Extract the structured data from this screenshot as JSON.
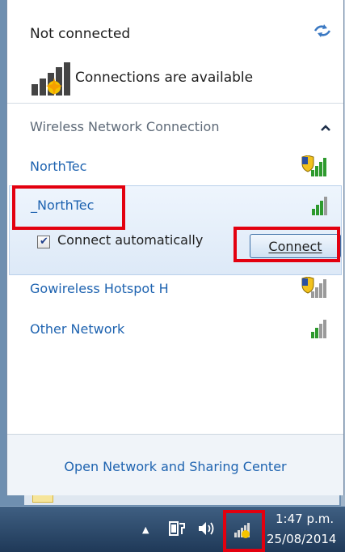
{
  "header": {
    "status": "Not connected",
    "available": "Connections are available"
  },
  "section": {
    "title": "Wireless Network Connection"
  },
  "networks": [
    {
      "name": "NorthTec",
      "secured": true
    },
    {
      "name": "_NorthTec",
      "secured": false
    },
    {
      "name": "Gowireless Hotspot H",
      "secured": true
    },
    {
      "name": "Other Network",
      "secured": false
    }
  ],
  "selected": {
    "connect_auto_label": "Connect automatically",
    "connect_auto_checked": true,
    "connect_label": "Connect"
  },
  "footer": {
    "link": "Open Network and Sharing Center"
  },
  "taskbar": {
    "time": "1:47 p.m.",
    "date": "25/08/2014"
  },
  "colors": {
    "link_blue": "#1e63b0",
    "highlight": "#e3000f",
    "signal_green": "#2e9a2e"
  },
  "icons": [
    "refresh-icon",
    "network-available-icon",
    "collapse-icon",
    "signal-icon",
    "shield-icon",
    "volume-icon",
    "power-icon"
  ]
}
